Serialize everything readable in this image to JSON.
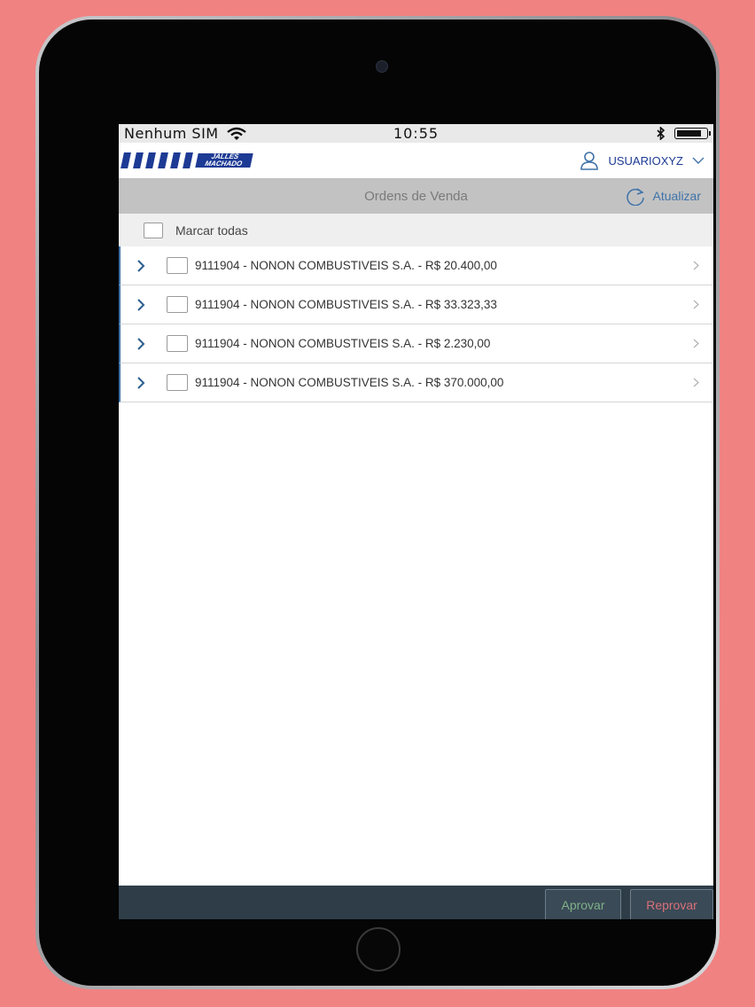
{
  "status_bar": {
    "carrier": "Nenhum SIM",
    "time": "10:55",
    "battery_level": 0.85
  },
  "header": {
    "logo_line1": "JALLES",
    "logo_line2": "MACHADO",
    "username": "USUARIOXYZ"
  },
  "toolbar": {
    "title": "Ordens de Venda",
    "refresh_label": "Atualizar"
  },
  "select_all": {
    "label": "Marcar todas"
  },
  "orders": [
    {
      "text": "9111904 - NONON  COMBUSTIVEIS S.A. - R$  20.400,00"
    },
    {
      "text": "9111904 - NONON  COMBUSTIVEIS S.A. - R$ 33.323,33"
    },
    {
      "text": "9111904 - NONON  COMBUSTIVEIS S.A. - R$ 2.230,00"
    },
    {
      "text": "9111904 - NONON  COMBUSTIVEIS S.A. - R$ 370.000,00"
    }
  ],
  "actions": {
    "approve_label": "Aprovar",
    "reject_label": "Reprovar"
  },
  "colors": {
    "background": "#f08282",
    "brand_blue": "#1d3a94",
    "accent_blue": "#3f73a8",
    "toolbar_gray": "#c2c2c2",
    "bottom_bar": "#2f3d48",
    "approve_text": "#7fb08a",
    "reject_text": "#d9707a"
  }
}
